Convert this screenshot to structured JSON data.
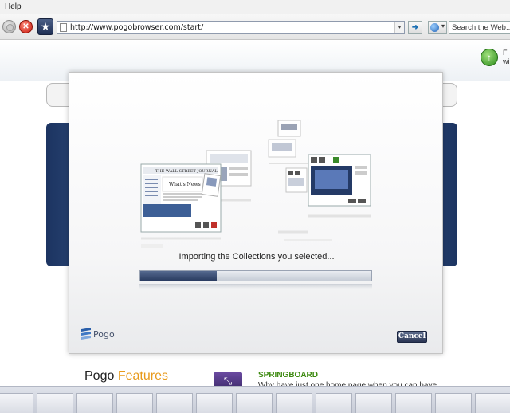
{
  "menubar": {
    "help": "Help"
  },
  "toolbar": {
    "url": "http://www.pogobrowser.com/start/",
    "search_placeholder": "Search the Web...",
    "stop_glyph": "✕",
    "bookmark_glyph": "★",
    "go_glyph": "➜",
    "url_dropdown_glyph": "▾"
  },
  "page": {
    "right_text": "Fi\nwi",
    "features_prefix": "Pogo",
    "features_accent": "Features",
    "springboard_title": "SPRINGBOARD",
    "springboard_desc": "Why have just one home page when you can have"
  },
  "modal": {
    "status": "Importing the Collections you selected...",
    "progress_fraction": 0.33,
    "logo_text": "Pogo",
    "cancel_label": "Cancel",
    "newspaper_masthead": "THE WALL STREET JOURNAL",
    "newspaper_headline": "What's News"
  },
  "colors": {
    "accent_orange": "#e89a1b",
    "springboard_green": "#3d8a10",
    "progress_fill": "#2a3c61",
    "pogo_blue": "#1d5fb4"
  },
  "icons": [
    "back-icon",
    "stop-icon",
    "bookmark-star-icon",
    "page-icon",
    "go-arrow-icon",
    "search-engine-icon",
    "green-up-arrow-icon",
    "springboard-icon",
    "pogo-logo-icon"
  ]
}
